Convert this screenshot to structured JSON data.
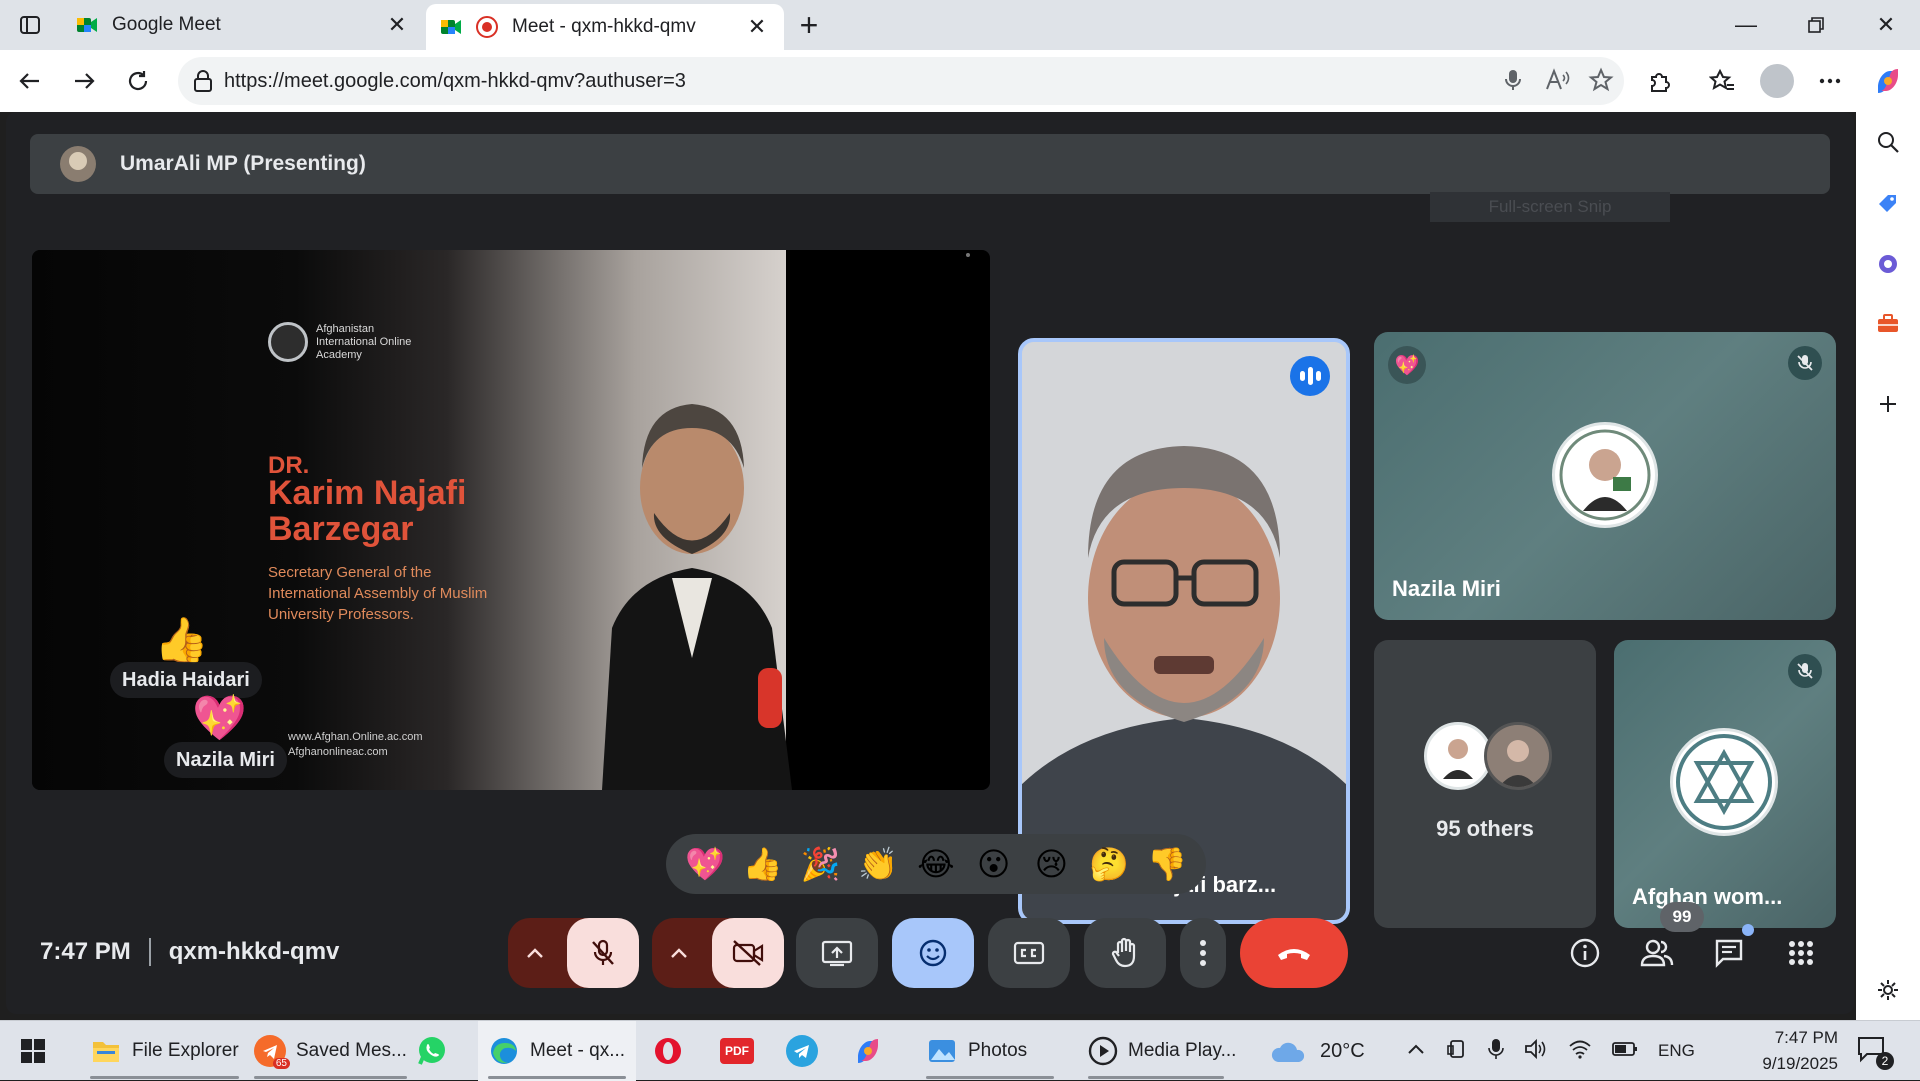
{
  "browser": {
    "tabs": [
      {
        "title": "Google Meet"
      },
      {
        "title": "Meet - qxm-hkkd-qmv"
      }
    ],
    "url": "https://meet.google.com/qxm-hkkd-qmv?authuser=3"
  },
  "meet": {
    "presenter_label": "UmarAli MP (Presenting)",
    "snip_hint": "Full-screen Snip",
    "slide": {
      "logo_text": "Afghanistan International Online Academy",
      "dr": "DR.",
      "name_line1": "Karim Najafi",
      "name_line2": "Barzegar",
      "role": "Secretary General of the International Assembly of Muslim University Professors.",
      "web_line1": "www.Afghan.Online.ac.com",
      "web_line2": "Afghanonlineac.com"
    },
    "reactions_on_screen": [
      {
        "emoji": "👍",
        "name": "Hadia Haidari"
      },
      {
        "emoji": "💖",
        "name": "Nazila Miri"
      }
    ],
    "tiles": {
      "karim": {
        "name": "Karim Najafi barz..."
      },
      "nazila": {
        "name": "Nazila Miri"
      },
      "others": {
        "label": "95 others"
      },
      "afghan": {
        "name": "Afghan wom..."
      }
    },
    "reaction_tray": [
      "💖",
      "👍",
      "🎉",
      "👏",
      "😂",
      "😮",
      "😢",
      "🤔",
      "👎"
    ],
    "bottom": {
      "time": "7:47 PM",
      "meeting_code": "qxm-hkkd-qmv",
      "people_count": "99"
    }
  },
  "taskbar": {
    "items": [
      {
        "label": "File Explorer"
      },
      {
        "label": "Saved Mes..."
      },
      {
        "label": "Meet - qx..."
      },
      {
        "label": "Photos"
      },
      {
        "label": "Media Play..."
      }
    ],
    "telegram_badge": "65",
    "weather": "20°C",
    "language": "ENG",
    "clock_time": "7:47 PM",
    "clock_date": "9/19/2025",
    "notification_count": "2"
  },
  "colors": {
    "meet_bg": "#202124",
    "tile_grey": "#3c4043",
    "end_call": "#ea4335",
    "active_border": "#a8c7fa"
  }
}
